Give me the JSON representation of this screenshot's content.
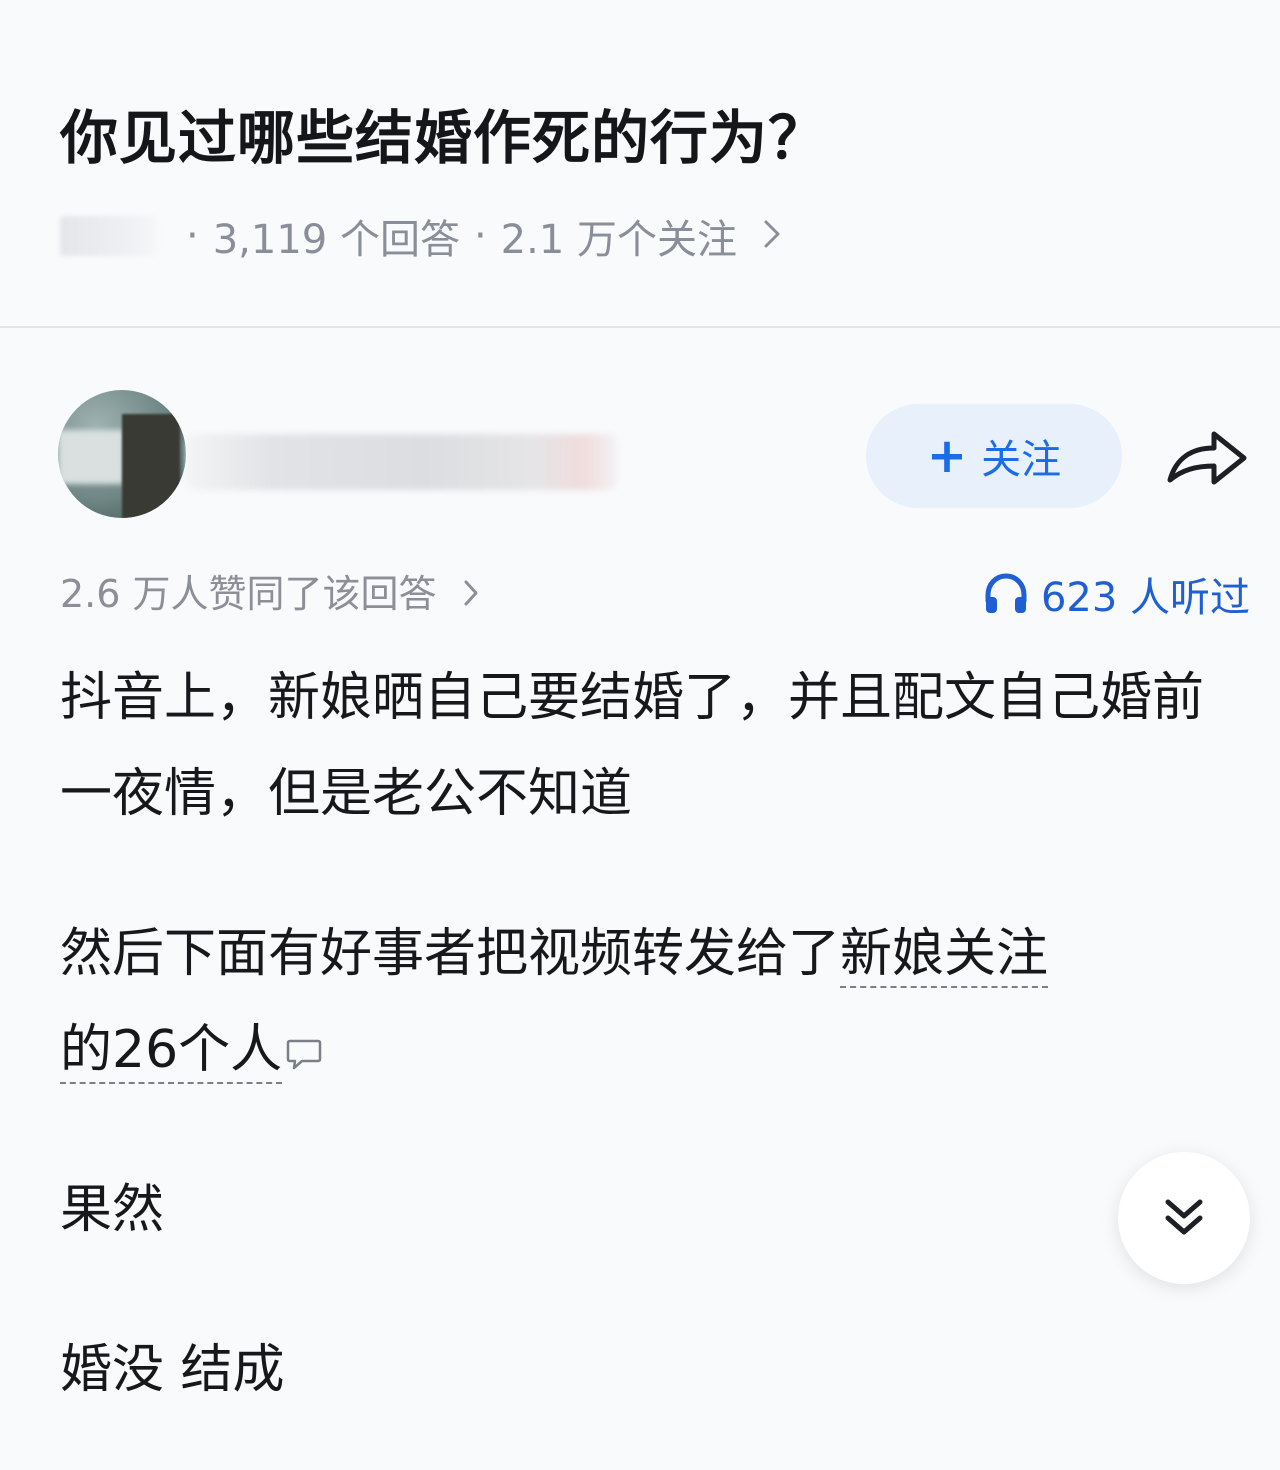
{
  "question": {
    "title": "你见过哪些结婚作死的行为？",
    "answer_count": "3,119 个回答",
    "follower_count": "2.1 万个关注",
    "separator": "·"
  },
  "author": {
    "follow_label": "关注",
    "follow_prefix": "+"
  },
  "stats": {
    "upvote_text": "2.6 万人赞同了该回答",
    "upvote_chevron": "›",
    "listen_text": "623 人听过"
  },
  "answer": {
    "paragraph1": "抖音上，新娘晒自己要结婚了，并且配文自己婚前一夜情，但是老公不知道",
    "paragraph2_prefix": "然后下面有好事者把视频转发给了",
    "paragraph2_keyword_a": "新娘关注",
    "paragraph2_keyword_b": "的26个人",
    "paragraph3": "果然",
    "paragraph4": "婚没 结成"
  },
  "icons": {
    "share": "share-arrow-icon",
    "headphone": "headphone-icon",
    "comment": "comment-bubble-icon",
    "expand": "double-chevron-down-icon",
    "meta_chevron": "chevron-right-icon"
  },
  "colors": {
    "accent_blue": "#1a6ce8",
    "follow_bg": "#e8f0fb",
    "meta_grey": "#8a8e98",
    "text": "#17181c"
  }
}
